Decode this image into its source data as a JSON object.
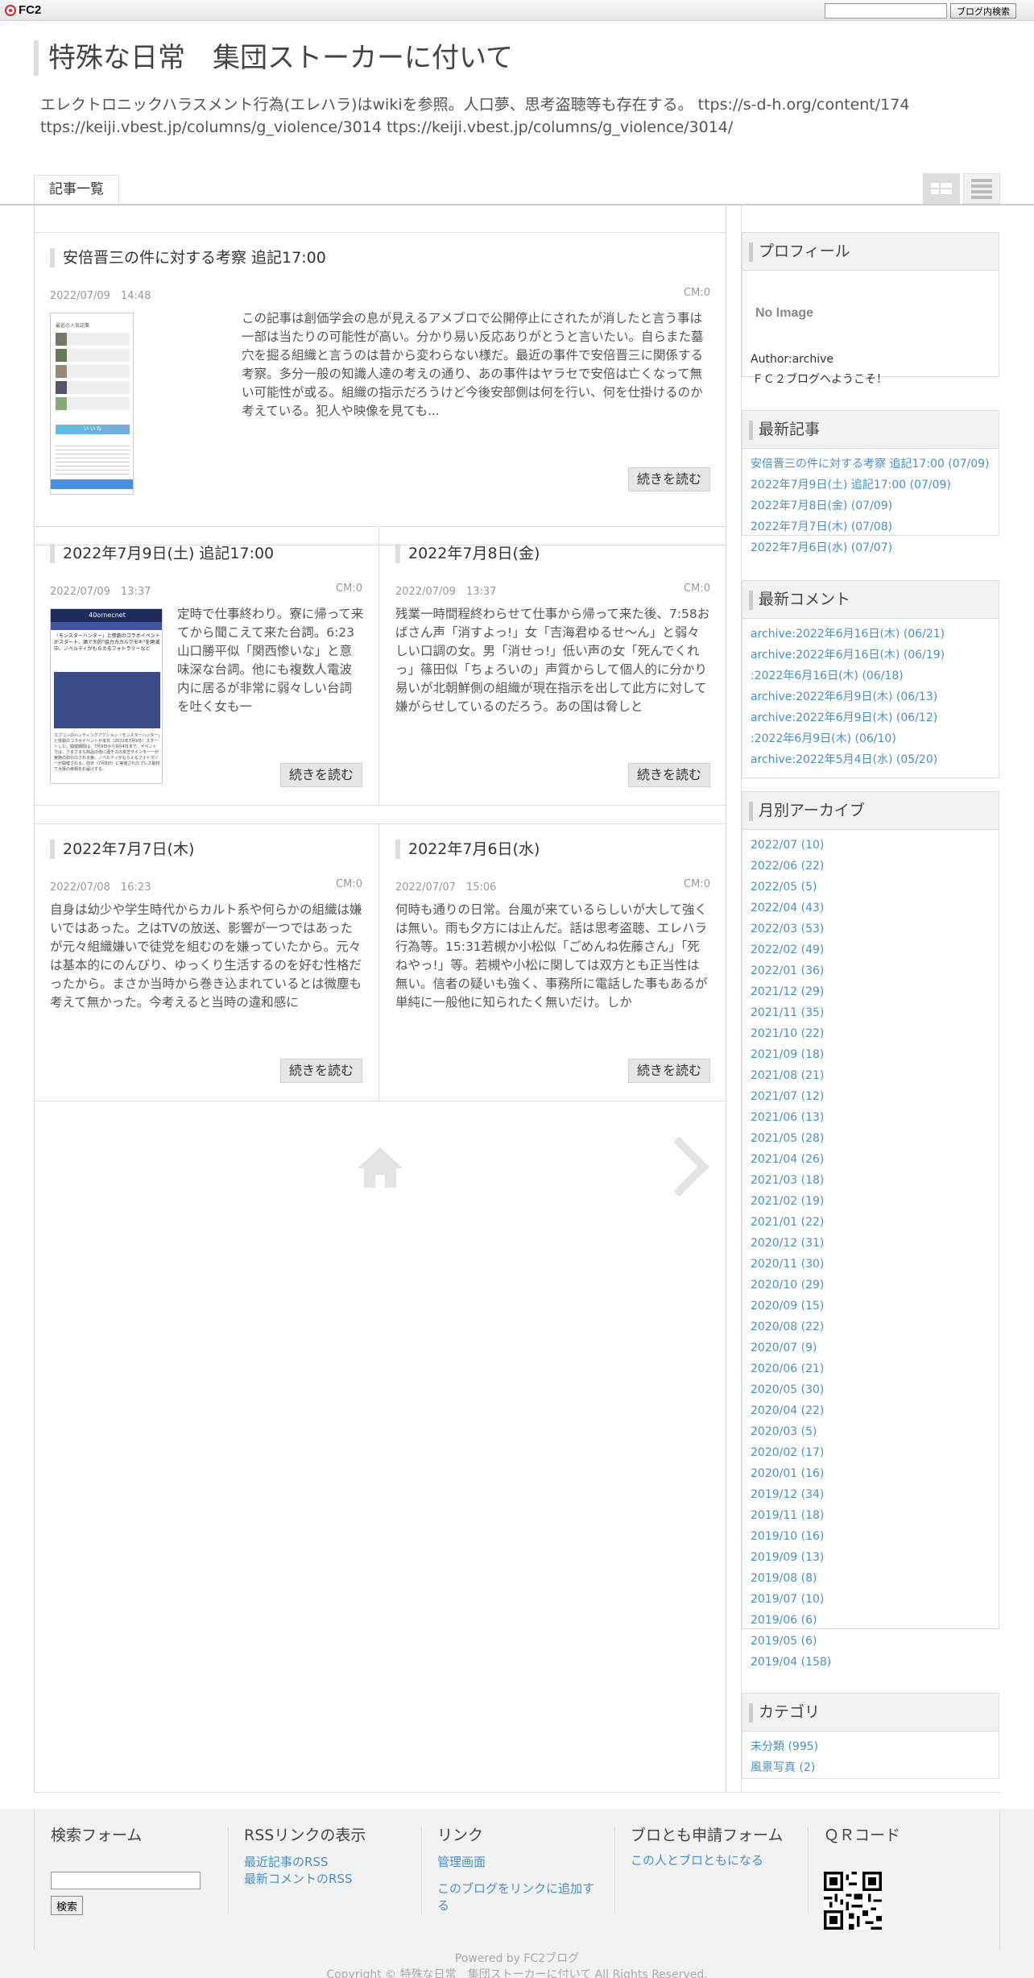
{
  "topbar": {
    "logo": "FC2",
    "search_button": "ブログ内検索"
  },
  "header": {
    "title": "特殊な日常　集団ストーカーに付いて",
    "description": "エレクトロニックハラスメント行為(エレハラ)はwikiを参照。人口夢、思考盗聴等も存在する。 ttps://s-d-h.org/content/174 ttps://keiji.vbest.jp/columns/g_violence/3014 ttps://keiji.vbest.jp/columns/g_violence/3014/"
  },
  "nav": {
    "tab_articles": "記事一覧",
    "icons": [
      "grid-view-icon",
      "list-view-icon"
    ]
  },
  "entries": [
    {
      "title": "安倍晋三の件に対する考察 追記17:00",
      "date": "2022/07/09　14:48",
      "cm": "CM:0",
      "body": "この記事は創価学会の息が見えるアメブロで公開停止にされたが消したと言う事は一部は当たりの可能性が高い。分かり易い反応ありがとうと言いたい。自らまた墓穴を掘る組織と言うのは昔から変わらない様だ。最近の事件で安倍晋三に関係する考察。多分一般の知識人達の考えの通り、あの事件はヤラセで安倍は亡くなって無い可能性が或る。組織の指示だろうけど今後安部側は何を行い、何を仕掛けるのか考えている。犯人や映像を見ても...",
      "read_more": "続きを読む"
    },
    {
      "title": "2022年7月9日(土) 追記17:00",
      "date": "2022/07/09　13:37",
      "cm": "CM:0",
      "body": "定時で仕事終わり。寮に帰って来てから聞こえて来た台詞。6:23山口勝平似「関西惨いな」と意味深な台詞。他にも複数人電波内に居るが非常に弱々しい台詞を吐く女も一",
      "read_more": "続きを読む"
    },
    {
      "title": "2022年7月8日(金)",
      "date": "2022/07/09　13:37",
      "cm": "CM:0",
      "body": "残業一時間程終わらせて仕事から帰って来た後、7:58おばさん声「消すよっ!」女「吉海君ゆるせ～ん」と弱々しい口調の女。男「消せっ!」低い声の女「死んでくれっ」篠田似「ちょろいの」声質からして個人的に分かり易いが北朝鮮側の組織が現在指示を出して此方に対して嫌がらせしているのだろう。あの国は脅しと",
      "read_more": "続きを読む"
    },
    {
      "title": "2022年7月7日(木)",
      "date": "2022/07/08　16:23",
      "cm": "CM:0",
      "body": "自身は幼少や学生時代からカルト系や何らかの組織は嫌いではあった。之はTVの放送、影響が一つではあったが元々組織嫌いで徒党を組むのを嫌っていたから。元々は基本的にのんびり、ゆっくり生活するのを好む性格だったから。まさか当時から巻き込まれているとは微塵も考えて無かった。今考えると当時の違和感に",
      "read_more": "続きを読む"
    },
    {
      "title": "2022年7月6日(水)",
      "date": "2022/07/07　15:06",
      "cm": "CM:0",
      "body": "何時も通りの日常。台風が来ているらしいが大して強くは無い。雨も夕方には止んだ。話は思考盗聴、エレハラ行為等。15:31若槻か小松似「ごめんね佐藤さん」「死ねやっ!」等。若槻や小松に関しては双方とも正当性は無い。信者の疑いも強く、事務所に電話した事もあるが単純に一般他に知られたく無いだけ。しか",
      "read_more": "続きを読む"
    }
  ],
  "thumbnails": {
    "entry1": {
      "heading": "最近の人気記事",
      "buttons": [
        "い",
        "い",
        "ね"
      ]
    },
    "entry2": {
      "header": "40ornecnet",
      "headline": "「モンスターハンター」と惨劇のコラボイベントがスタート、酒で大的\"協力カカルクモキ\"を絶滅中、ノベルティがもらえるフォトラリーなど",
      "text": "カプコンのハンティングアクション「モンスターハンター」と惨劇のコラボイベントが本日（2022年7月9日）スタートした。開催期間は、7月9日から9月4日まで。イベントでは、さまざまな商品の他に酒千カの京芝ザインモー一が実施の割引のされる第。ノベルティがもらえるフォトラリーが開催される。前日（7月8日）に実施されたプレス取材で大阪の様相をお届けする。"
    }
  },
  "pager": {
    "icons": [
      "home-icon",
      "next-arrow-icon"
    ]
  },
  "sidebar": {
    "profile": {
      "title": "プロフィール",
      "noimage": "No Image",
      "author": "Author:archive",
      "welcome": "ＦＣ２ブログへようこそ！"
    },
    "recent_entries": {
      "title": "最新記事",
      "items": [
        "安倍晋三の件に対する考察 追記17:00 (07/09)",
        "2022年7月9日(土) 追記17:00 (07/09)",
        "2022年7月8日(金) (07/09)",
        "2022年7月7日(木) (07/08)",
        "2022年7月6日(水) (07/07)"
      ]
    },
    "recent_comments": {
      "title": "最新コメント",
      "items": [
        "archive:2022年6月16日(木) (06/21)",
        "archive:2022年6月16日(木) (06/19)",
        ":2022年6月16日(木) (06/18)",
        "archive:2022年6月9日(木) (06/13)",
        "archive:2022年6月9日(木) (06/12)",
        ":2022年6月9日(木) (06/10)",
        "archive:2022年5月4日(水) (05/20)"
      ]
    },
    "archive": {
      "title": "月別アーカイブ",
      "items": [
        "2022/07 (10)",
        "2022/06 (22)",
        "2022/05 (5)",
        "2022/04 (43)",
        "2022/03 (53)",
        "2022/02 (49)",
        "2022/01 (36)",
        "2021/12 (29)",
        "2021/11 (35)",
        "2021/10 (22)",
        "2021/09 (18)",
        "2021/08 (21)",
        "2021/07 (12)",
        "2021/06 (13)",
        "2021/05 (28)",
        "2021/04 (26)",
        "2021/03 (18)",
        "2021/02 (19)",
        "2021/01 (22)",
        "2020/12 (31)",
        "2020/11 (30)",
        "2020/10 (29)",
        "2020/09 (15)",
        "2020/08 (22)",
        "2020/07 (9)",
        "2020/06 (21)",
        "2020/05 (30)",
        "2020/04 (22)",
        "2020/03 (5)",
        "2020/02 (17)",
        "2020/01 (16)",
        "2019/12 (34)",
        "2019/11 (18)",
        "2019/10 (16)",
        "2019/09 (13)",
        "2019/08 (8)",
        "2019/07 (10)",
        "2019/06 (6)",
        "2019/05 (6)",
        "2019/04 (158)"
      ]
    },
    "category": {
      "title": "カテゴリ",
      "items": [
        "未分類 (995)",
        "風景写真 (2)"
      ]
    }
  },
  "footer": {
    "search": {
      "title": "検索フォーム",
      "button": "検索"
    },
    "rss": {
      "title": "RSSリンクの表示",
      "links": [
        "最近記事のRSS",
        "最新コメントのRSS"
      ]
    },
    "links": {
      "title": "リンク",
      "links": [
        "管理画面",
        "このブログをリンクに追加する"
      ]
    },
    "friend": {
      "title": "ブロとも申請フォーム",
      "links": [
        "この人とブロともになる"
      ]
    },
    "qr": {
      "title": "ＱＲコード"
    },
    "powered": "Powered by FC2ブログ",
    "copyright": "Copyright © 特殊な日常　集団ストーカーに付いて All Rights Reserved."
  },
  "colors": {
    "link": "#4a90c8",
    "border": "#dddddd",
    "panel": "#f2f2f2"
  }
}
